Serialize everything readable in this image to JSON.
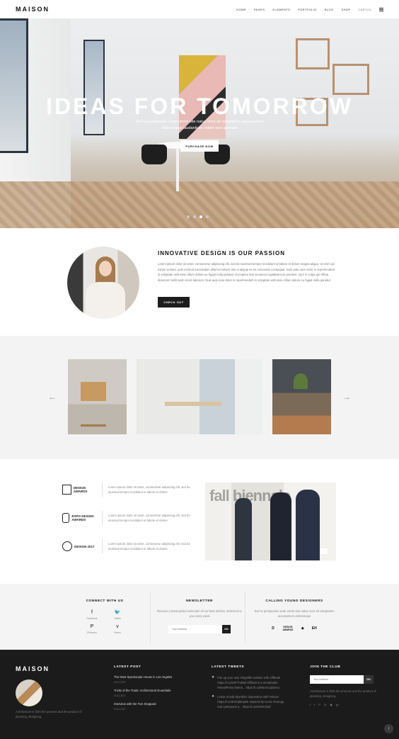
{
  "header": {
    "logo": "MAISON",
    "nav": [
      "HOME",
      "PAGES",
      "ELEMENTS",
      "PORTFOLIO",
      "BLOG",
      "SHOP"
    ],
    "cart": "CART(0)",
    "menu_icon": "hamburger-icon"
  },
  "hero": {
    "title": "IDEAS FOR TOMORROW",
    "subtitle": "Sed ut perspiciatis unde omnis iste natus error sit voluptatem accusantium doloremque laudantium, totam rem aperiam",
    "button": "PURCHASE NOW",
    "slides": 4,
    "active_slide": 3
  },
  "passion": {
    "title": "INNOVATIVE DESIGN IS OUR PASSION",
    "body": "Lorem ipsum dolor sit amet, consectetur adipiscing elit, sed do eiusmod tempor incididunt ut labore et dolore magna aliqua. Ut enim ad minim veniam, quis nostrud exercitation ullamco laboris nisi ut aliquip ex ea commodo consequat. Duis aute irure dolor in reprehenderit in voluptate velit esse cillum dolore eu fugiat nulla pariatur. Excepteur sint occaecat cupidatat non proident, sunt in culpa qui officia deserunt mollit anim id est laborum. Duis aute irure dolor in reprehenderit in voluptate velit esse cillum dolore eu fugiat nulla pariatur.",
    "button": "CHECK OUT"
  },
  "gallery": {
    "prev_icon": "arrow-left-icon",
    "next_icon": "arrow-right-icon",
    "prev": "←",
    "next": "→"
  },
  "awards": {
    "items": [
      {
        "logo": "DESIGN AWARDS",
        "text": "Lorem ipsum dolor sit amet, consectetur adipiscing elit, sed do eiusmod tempor incididunt ut labore et dolore"
      },
      {
        "logo": "EXPO DESIGN AWARDS",
        "text": "Lorem ipsum dolor sit amet, consectetur adipiscing elit, sed do eiusmod tempor incididunt ut labore et dolore"
      },
      {
        "logo": "DESIGN 2017",
        "text": "Lorem ipsum dolor sit amet, consectetur adipiscing elit, sed do eiusmod tempor incididunt ut labore et dolore"
      }
    ]
  },
  "connect": {
    "title": "CONNECT WITH US",
    "items": [
      {
        "icon": "facebook-icon",
        "glyph": "f",
        "label": "Facebook"
      },
      {
        "icon": "twitter-icon",
        "glyph": "🐦",
        "label": "Twitter"
      },
      {
        "icon": "pinterest-icon",
        "glyph": "P",
        "label": "Pinterest"
      },
      {
        "icon": "vimeo-icon",
        "glyph": "v",
        "label": "Vimeo"
      }
    ]
  },
  "newsletter": {
    "title": "NEWSLETTER",
    "text": "Receive a hand-picked selection of our best articles, delivered to you every week",
    "placeholder": "Your Address",
    "button": "GO"
  },
  "young": {
    "title": "CALLING YOUNG DESIGNERS",
    "text": "Sed ut perspiciatis unde omnis iste natus error sit voluptatem accusantium doloremque",
    "logos": [
      "D",
      "DESIGN AWARDS",
      "◈",
      "EH"
    ]
  },
  "footer": {
    "logo": "MAISON",
    "about": "Architecture is both the process and the product of planning, designing.",
    "latest_post_title": "LATEST POST",
    "posts": [
      {
        "title": "The Most Spectacular House in Los Angeles",
        "date": "04.11.2017"
      },
      {
        "title": "Tricks of the Trade: Architectural Guardrails",
        "date": "04.11.2017"
      },
      {
        "title": "Interview with the Tom Stoppard",
        "date": "04.11.2017"
      }
    ],
    "latest_tweets_title": "LATEST TWEETS",
    "tweets": [
      "Fire up your own #nightlife website with Offbeat! https://t.co/wR7Yub85 Offbeat is a remarkable #WordPress theme... https://t.co/N6AmUZDeno",
      "Leave a bold #portfolio impression with Tebow! https://t.co/DOSj9KiyBK Inspired by iconic #manga and cyberpunk a... https://t.co/ZsKKG6af"
    ],
    "join_title": "JOIN THE CLUB",
    "join_placeholder": "Your Address",
    "join_button": "GO",
    "join_text": "Architecture is both the process and the product of planning, designing.",
    "social": [
      "f",
      "t",
      "P",
      "◎",
      "◉",
      "g+"
    ]
  }
}
